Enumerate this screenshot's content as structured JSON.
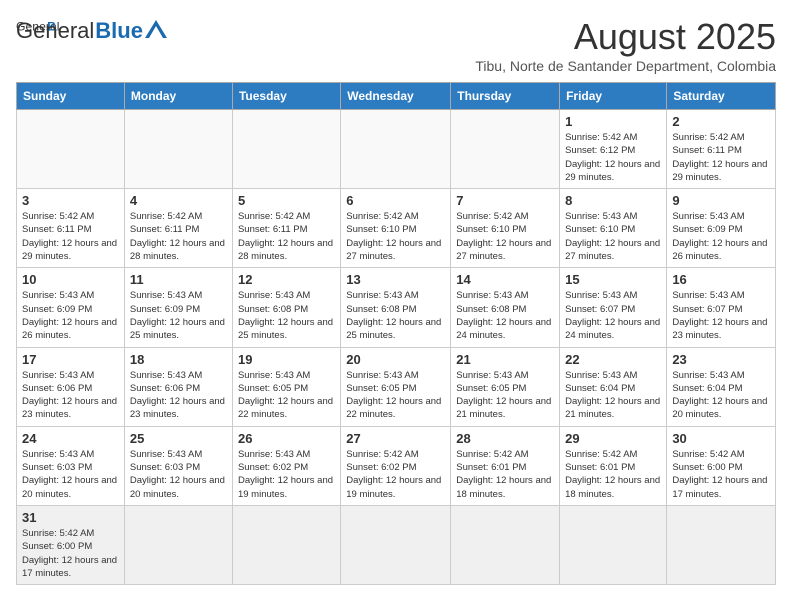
{
  "header": {
    "logo_general": "General",
    "logo_blue": "Blue",
    "month_year": "August 2025",
    "location": "Tibu, Norte de Santander Department, Colombia"
  },
  "days_of_week": [
    "Sunday",
    "Monday",
    "Tuesday",
    "Wednesday",
    "Thursday",
    "Friday",
    "Saturday"
  ],
  "weeks": [
    [
      {
        "day": "",
        "info": ""
      },
      {
        "day": "",
        "info": ""
      },
      {
        "day": "",
        "info": ""
      },
      {
        "day": "",
        "info": ""
      },
      {
        "day": "",
        "info": ""
      },
      {
        "day": "1",
        "info": "Sunrise: 5:42 AM\nSunset: 6:12 PM\nDaylight: 12 hours and 29 minutes."
      },
      {
        "day": "2",
        "info": "Sunrise: 5:42 AM\nSunset: 6:11 PM\nDaylight: 12 hours and 29 minutes."
      }
    ],
    [
      {
        "day": "3",
        "info": "Sunrise: 5:42 AM\nSunset: 6:11 PM\nDaylight: 12 hours and 29 minutes."
      },
      {
        "day": "4",
        "info": "Sunrise: 5:42 AM\nSunset: 6:11 PM\nDaylight: 12 hours and 28 minutes."
      },
      {
        "day": "5",
        "info": "Sunrise: 5:42 AM\nSunset: 6:11 PM\nDaylight: 12 hours and 28 minutes."
      },
      {
        "day": "6",
        "info": "Sunrise: 5:42 AM\nSunset: 6:10 PM\nDaylight: 12 hours and 27 minutes."
      },
      {
        "day": "7",
        "info": "Sunrise: 5:42 AM\nSunset: 6:10 PM\nDaylight: 12 hours and 27 minutes."
      },
      {
        "day": "8",
        "info": "Sunrise: 5:43 AM\nSunset: 6:10 PM\nDaylight: 12 hours and 27 minutes."
      },
      {
        "day": "9",
        "info": "Sunrise: 5:43 AM\nSunset: 6:09 PM\nDaylight: 12 hours and 26 minutes."
      }
    ],
    [
      {
        "day": "10",
        "info": "Sunrise: 5:43 AM\nSunset: 6:09 PM\nDaylight: 12 hours and 26 minutes."
      },
      {
        "day": "11",
        "info": "Sunrise: 5:43 AM\nSunset: 6:09 PM\nDaylight: 12 hours and 25 minutes."
      },
      {
        "day": "12",
        "info": "Sunrise: 5:43 AM\nSunset: 6:08 PM\nDaylight: 12 hours and 25 minutes."
      },
      {
        "day": "13",
        "info": "Sunrise: 5:43 AM\nSunset: 6:08 PM\nDaylight: 12 hours and 25 minutes."
      },
      {
        "day": "14",
        "info": "Sunrise: 5:43 AM\nSunset: 6:08 PM\nDaylight: 12 hours and 24 minutes."
      },
      {
        "day": "15",
        "info": "Sunrise: 5:43 AM\nSunset: 6:07 PM\nDaylight: 12 hours and 24 minutes."
      },
      {
        "day": "16",
        "info": "Sunrise: 5:43 AM\nSunset: 6:07 PM\nDaylight: 12 hours and 23 minutes."
      }
    ],
    [
      {
        "day": "17",
        "info": "Sunrise: 5:43 AM\nSunset: 6:06 PM\nDaylight: 12 hours and 23 minutes."
      },
      {
        "day": "18",
        "info": "Sunrise: 5:43 AM\nSunset: 6:06 PM\nDaylight: 12 hours and 23 minutes."
      },
      {
        "day": "19",
        "info": "Sunrise: 5:43 AM\nSunset: 6:05 PM\nDaylight: 12 hours and 22 minutes."
      },
      {
        "day": "20",
        "info": "Sunrise: 5:43 AM\nSunset: 6:05 PM\nDaylight: 12 hours and 22 minutes."
      },
      {
        "day": "21",
        "info": "Sunrise: 5:43 AM\nSunset: 6:05 PM\nDaylight: 12 hours and 21 minutes."
      },
      {
        "day": "22",
        "info": "Sunrise: 5:43 AM\nSunset: 6:04 PM\nDaylight: 12 hours and 21 minutes."
      },
      {
        "day": "23",
        "info": "Sunrise: 5:43 AM\nSunset: 6:04 PM\nDaylight: 12 hours and 20 minutes."
      }
    ],
    [
      {
        "day": "24",
        "info": "Sunrise: 5:43 AM\nSunset: 6:03 PM\nDaylight: 12 hours and 20 minutes."
      },
      {
        "day": "25",
        "info": "Sunrise: 5:43 AM\nSunset: 6:03 PM\nDaylight: 12 hours and 20 minutes."
      },
      {
        "day": "26",
        "info": "Sunrise: 5:43 AM\nSunset: 6:02 PM\nDaylight: 12 hours and 19 minutes."
      },
      {
        "day": "27",
        "info": "Sunrise: 5:42 AM\nSunset: 6:02 PM\nDaylight: 12 hours and 19 minutes."
      },
      {
        "day": "28",
        "info": "Sunrise: 5:42 AM\nSunset: 6:01 PM\nDaylight: 12 hours and 18 minutes."
      },
      {
        "day": "29",
        "info": "Sunrise: 5:42 AM\nSunset: 6:01 PM\nDaylight: 12 hours and 18 minutes."
      },
      {
        "day": "30",
        "info": "Sunrise: 5:42 AM\nSunset: 6:00 PM\nDaylight: 12 hours and 17 minutes."
      }
    ],
    [
      {
        "day": "31",
        "info": "Sunrise: 5:42 AM\nSunset: 6:00 PM\nDaylight: 12 hours and 17 minutes."
      },
      {
        "day": "",
        "info": ""
      },
      {
        "day": "",
        "info": ""
      },
      {
        "day": "",
        "info": ""
      },
      {
        "day": "",
        "info": ""
      },
      {
        "day": "",
        "info": ""
      },
      {
        "day": "",
        "info": ""
      }
    ]
  ]
}
